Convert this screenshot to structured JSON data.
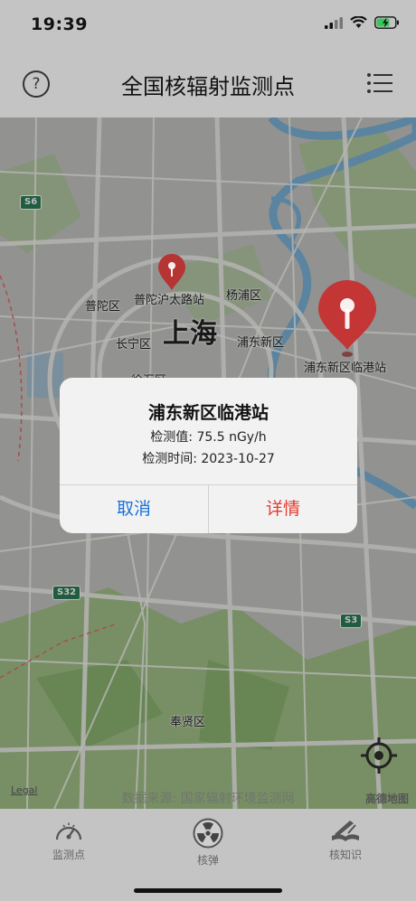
{
  "status": {
    "time": "19:39"
  },
  "nav": {
    "title": "全国核辐射监测点",
    "help_glyph": "?"
  },
  "map": {
    "city_label": "上海",
    "districts": [
      "普陀区",
      "杨浦区",
      "长宁区",
      "浦东新区",
      "奉贤区",
      "徐汇区"
    ],
    "stations": [
      "普陀沪太路站",
      "浦东新区临港站"
    ],
    "road_shields": [
      "S6",
      "S32",
      "S3"
    ],
    "legal": "Legal",
    "source": "数据来源: 国家辐射环境监测网",
    "provider": "高德地图"
  },
  "dialog": {
    "title": "浦东新区临港站",
    "value_line": "检测值: 75.5 nGy/h",
    "time_line": "检测时间: 2023-10-27",
    "cancel": "取消",
    "detail": "详情"
  },
  "tabs": [
    {
      "label": "监测点",
      "icon": "gauge-icon"
    },
    {
      "label": "核弹",
      "icon": "radiation-icon"
    },
    {
      "label": "核知识",
      "icon": "book-icon"
    }
  ],
  "colors": {
    "pin_red": "#d93c3c",
    "dialog_cancel": "#1a73d9",
    "dialog_detail": "#e53b30",
    "shield_green": "#2c7d55"
  }
}
